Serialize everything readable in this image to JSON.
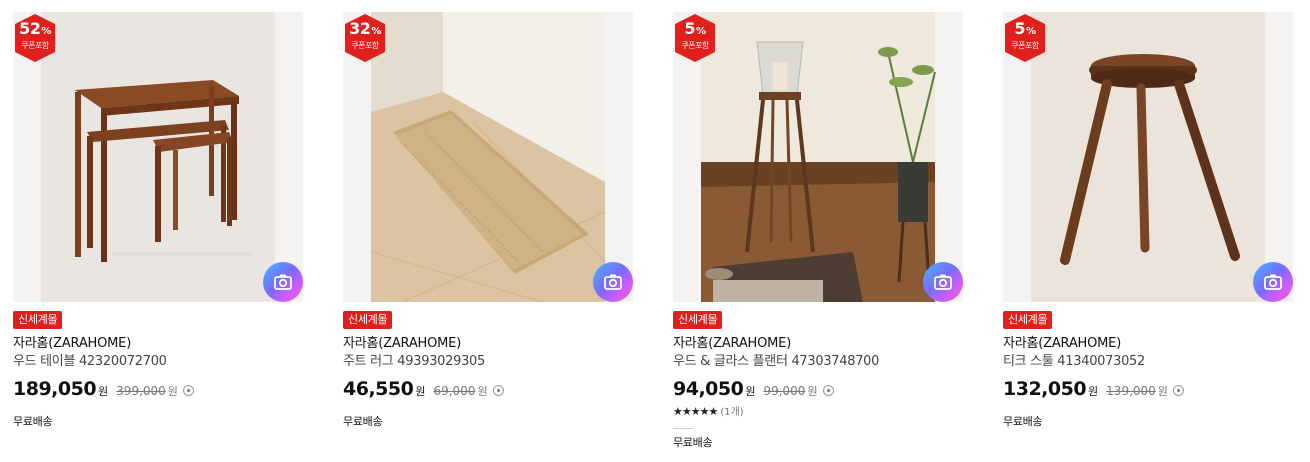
{
  "products": [
    {
      "discount": "52",
      "discount_unit": "%",
      "coupon_label": "쿠폰포함",
      "tag": "신세계몰",
      "brand": "자라홈(ZARAHOME)",
      "name": "우드 테이블 42320072700",
      "price": "189,050",
      "price_unit": "원",
      "original_price": "399,000",
      "original_unit": "원",
      "shipping": "무료배송",
      "image": "nesting-wood-tables"
    },
    {
      "discount": "32",
      "discount_unit": "%",
      "coupon_label": "쿠폰포함",
      "tag": "신세계몰",
      "brand": "자라홈(ZARAHOME)",
      "name": "주트 러그 49393029305",
      "price": "46,550",
      "price_unit": "원",
      "original_price": "69,000",
      "original_unit": "원",
      "shipping": "무료배송",
      "image": "jute-runner-rug"
    },
    {
      "discount": "5",
      "discount_unit": "%",
      "coupon_label": "쿠폰포함",
      "tag": "신세계몰",
      "brand": "자라홈(ZARAHOME)",
      "name": "우드 & 글라스 플랜터 47303748700",
      "price": "94,050",
      "price_unit": "원",
      "original_price": "99,000",
      "original_unit": "원",
      "rating_stars": "★★★★★",
      "rating_count": "(1개)",
      "shipping": "무료배송",
      "image": "wood-glass-planter"
    },
    {
      "discount": "5",
      "discount_unit": "%",
      "coupon_label": "쿠폰포함",
      "tag": "신세계몰",
      "brand": "자라홈(ZARAHOME)",
      "name": "티크 스툴 41340073052",
      "price": "132,050",
      "price_unit": "원",
      "original_price": "139,000",
      "original_unit": "원",
      "shipping": "무료배송",
      "image": "teak-stool"
    }
  ],
  "colors": {
    "badge_red": "#e0201c",
    "tag_red": "#e0201c",
    "camera_gradient": [
      "#41b9ff",
      "#7a6bff",
      "#d45bff",
      "#ff5a8a"
    ]
  },
  "icons": {
    "camera": "camera-search-icon",
    "info": "info-circle-icon"
  }
}
